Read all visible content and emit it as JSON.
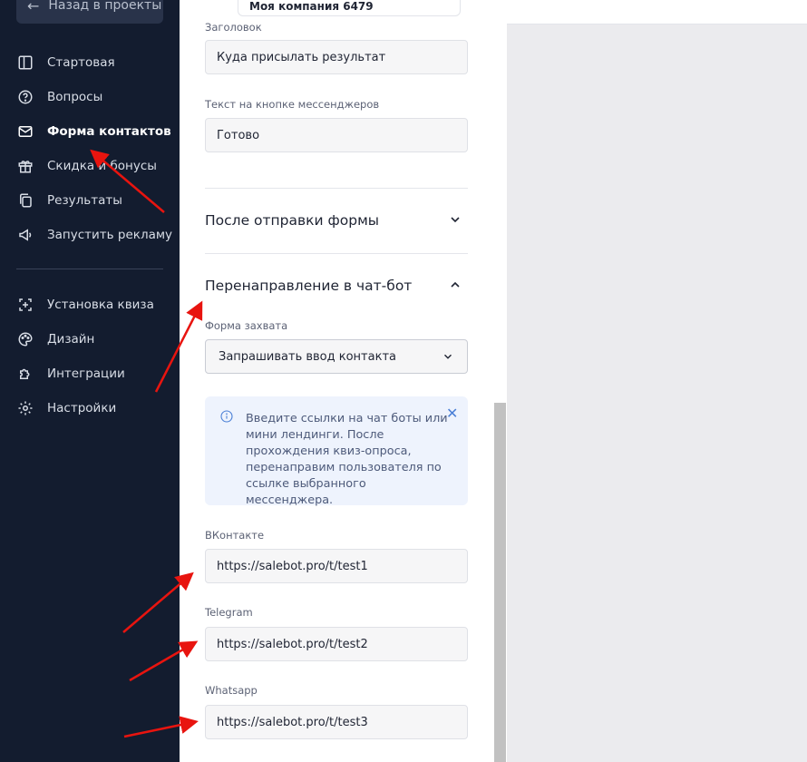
{
  "sidebar": {
    "back_label": "Назад в проекты",
    "items": [
      {
        "label": "Стартовая",
        "icon": "layout-icon",
        "active": false
      },
      {
        "label": "Вопросы",
        "icon": "question-icon",
        "active": false
      },
      {
        "label": "Форма контактов",
        "icon": "mail-icon",
        "active": true
      },
      {
        "label": "Скидка и бонусы",
        "icon": "gift-icon",
        "active": false
      },
      {
        "label": "Результаты",
        "icon": "copy-icon",
        "active": false
      },
      {
        "label": "Запустить рекламу",
        "icon": "megaphone-icon",
        "active": false
      }
    ],
    "items2": [
      {
        "label": "Установка квиза",
        "icon": "install-icon"
      },
      {
        "label": "Дизайн",
        "icon": "palette-icon"
      },
      {
        "label": "Интеграции",
        "icon": "puzzle-icon"
      },
      {
        "label": "Настройки",
        "icon": "gear-icon"
      }
    ]
  },
  "header": {
    "company": "Моя компания 6479"
  },
  "form": {
    "title_label": "Заголовок",
    "title_value": "Куда присылать результат",
    "button_label": "Текст на кнопке мессенджеров",
    "button_value": "Готово",
    "section_after": "После отправки формы",
    "section_redirect": "Перенаправление в чат-бот",
    "capture_label": "Форма захвата",
    "capture_value": "Запрашивать ввод контакта",
    "info_text": "Введите ссылки на чат боты или мини лендинги. После прохождения квиз-опроса, перенаправим пользователя по ссылке выбранного мессенджера.",
    "vk_label": "ВКонтакте",
    "vk_value": "https://salebot.pro/t/test1",
    "tg_label": "Telegram",
    "tg_value": "https://salebot.pro/t/test2",
    "wa_label": "Whatsapp",
    "wa_value": "https://salebot.pro/t/test3"
  },
  "colors": {
    "sidebar_bg": "#131c2f",
    "annotation_arrow": "#e8140f",
    "info_bg": "#eef3fd"
  }
}
